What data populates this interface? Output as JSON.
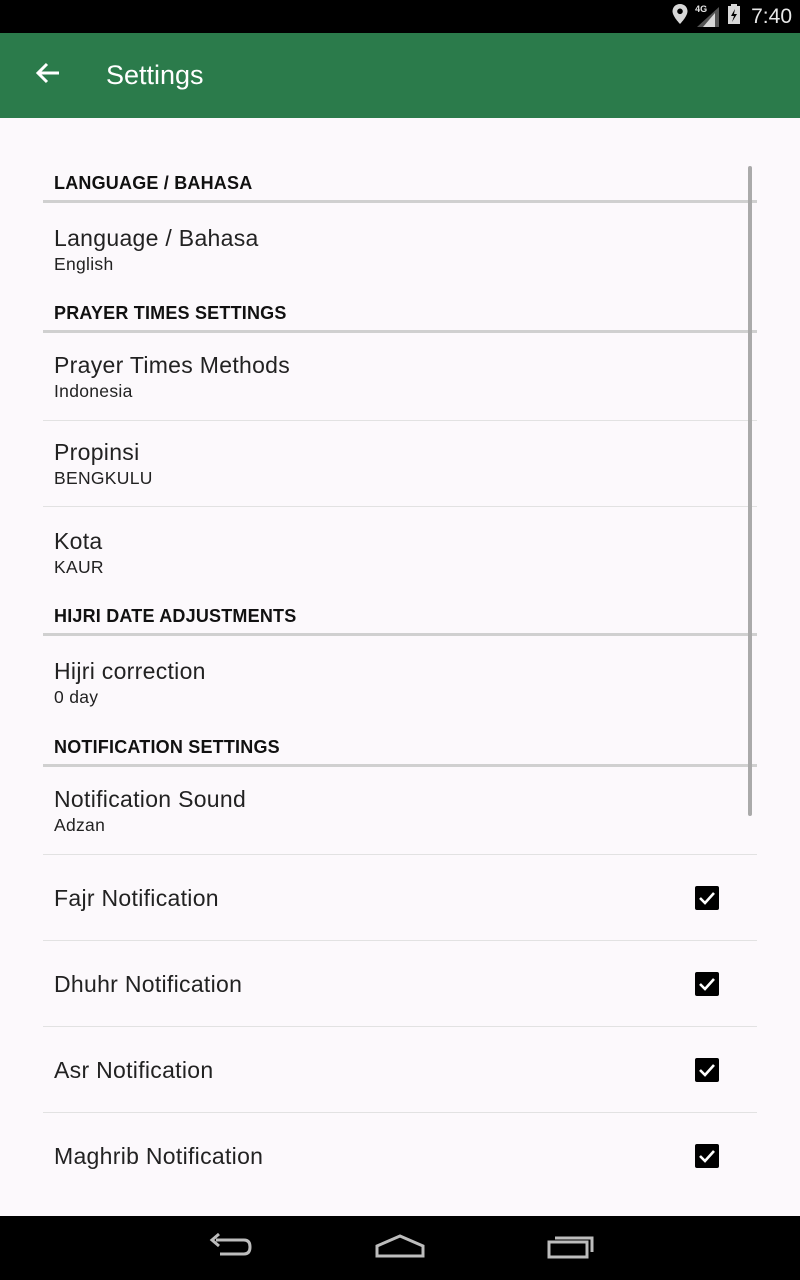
{
  "status_bar": {
    "time": "7:40",
    "network": "4G"
  },
  "app_bar": {
    "title": "Settings"
  },
  "sections": {
    "language": {
      "header": "LANGUAGE / BAHASA",
      "language_title": "Language / Bahasa",
      "language_value": "English"
    },
    "prayer": {
      "header": "PRAYER TIMES SETTINGS",
      "method_title": "Prayer Times Methods",
      "method_value": "Indonesia",
      "province_title": "Propinsi",
      "province_value": "BENGKULU",
      "city_title": "Kota",
      "city_value": "KAUR"
    },
    "hijri": {
      "header": "HIJRI DATE ADJUSTMENTS",
      "correction_title": "Hijri correction",
      "correction_value": "0 day"
    },
    "notification": {
      "header": "NOTIFICATION SETTINGS",
      "sound_title": "Notification Sound",
      "sound_value": "Adzan",
      "fajr_label": "Fajr Notification",
      "dhuhr_label": "Dhuhr Notification",
      "asr_label": "Asr Notification",
      "maghrib_label": "Maghrib Notification",
      "fajr_checked": true,
      "dhuhr_checked": true,
      "asr_checked": true,
      "maghrib_checked": true
    }
  },
  "colors": {
    "app_bar": "#2b7b4b",
    "background": "#fcf9fc",
    "checkbox": "#000000"
  }
}
